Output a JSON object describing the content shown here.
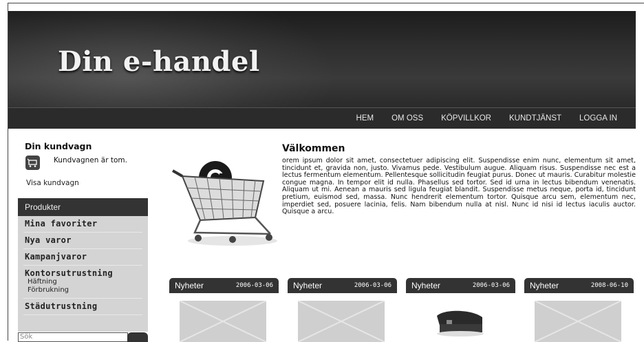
{
  "header": {
    "logo_prefix": "Din e-handel"
  },
  "nav": {
    "items": [
      "HEM",
      "OM OSS",
      "KÖPVILLKOR",
      "KUNDTJÄNST",
      "LOGGA IN"
    ]
  },
  "cart": {
    "title": "Din kundvagn",
    "empty_text": "Kundvagnen är tom.",
    "view_link": "Visa kundvagn",
    "icon": "cart-icon"
  },
  "products": {
    "heading": "Produkter",
    "items": [
      {
        "label": "Mina favoriter",
        "sub": []
      },
      {
        "label": "Nya varor",
        "sub": []
      },
      {
        "label": "Kampanjvaror",
        "sub": []
      },
      {
        "label": "Kontorsutrustning",
        "sub": [
          "Häftning",
          "Förbrukning"
        ]
      },
      {
        "label": "Städutrustning",
        "sub": []
      }
    ]
  },
  "search": {
    "placeholder": "Sök"
  },
  "welcome": {
    "title": "Välkommen",
    "text": "orem ipsum dolor sit amet, consectetuer adipiscing elit. Suspendisse enim nunc, elementum sit amet, tincidunt et, gravida non, justo. Vivamus pede. Vestibulum augue. Aliquam risus. Suspendisse nec est a lectus fermentum elementum. Pellentesque sollicitudin feugiat purus. Donec ut mauris. Curabitur molestie congue magna. In tempor elit id nulla. Phasellus sed tortor. Sed id urna in lectus bibendum venenatis. Aliquam ut mi. Aenean a mauris sed ligula feugiat blandit. Suspendisse metus neque, porta id, tincidunt pretium, euismod sed, massa. Nunc hendrerit elementum tortor. Quisque arcu sem, elementum nec, imperdiet sed, posuere lacinia, felis. Nam bibendum nulla at nisl. Nunc id nisi id lectus iaculis auctor. Quisque a arcu."
  },
  "news": [
    {
      "label": "Nyheter",
      "date": "2006-03-06"
    },
    {
      "label": "Nyheter",
      "date": "2006-03-06"
    },
    {
      "label": "Nyheter",
      "date": "2006-03-06"
    },
    {
      "label": "Nyheter",
      "date": "2008-06-10"
    }
  ],
  "colors": {
    "header_bg": "#2d2d2d",
    "panel_bg": "#d4d4d4",
    "dark_bar": "#333333"
  }
}
